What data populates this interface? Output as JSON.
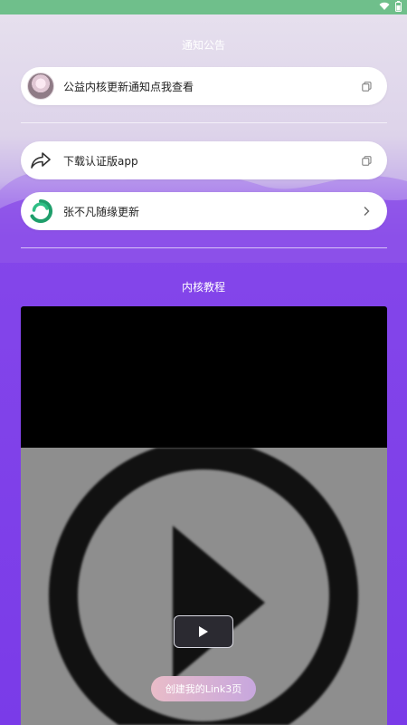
{
  "status_bar": {
    "icons": [
      "wifi-icon",
      "battery-icon"
    ]
  },
  "notice_section": {
    "title": "通知公告"
  },
  "cards": [
    {
      "label": "公益内核更新通知点我查看",
      "lead_icon": "avatar",
      "trail_icon": "copy-icon"
    },
    {
      "label": "下载认证版app",
      "lead_icon": "share-arrow-icon",
      "trail_icon": "copy-icon"
    },
    {
      "label": "张不凡随缘更新",
      "lead_icon": "logo-icon",
      "trail_icon": "chevron-right-icon"
    }
  ],
  "tutorial_section": {
    "title": "内核教程"
  },
  "video": {
    "play_icon": "play-icon"
  },
  "create_button": {
    "label": "创建我的Link3页"
  },
  "colors": {
    "accent": "#7a3be8",
    "status_bar": "#6fbf8b",
    "video_top": "#000000",
    "video_bottom": "#8e8e8e"
  }
}
